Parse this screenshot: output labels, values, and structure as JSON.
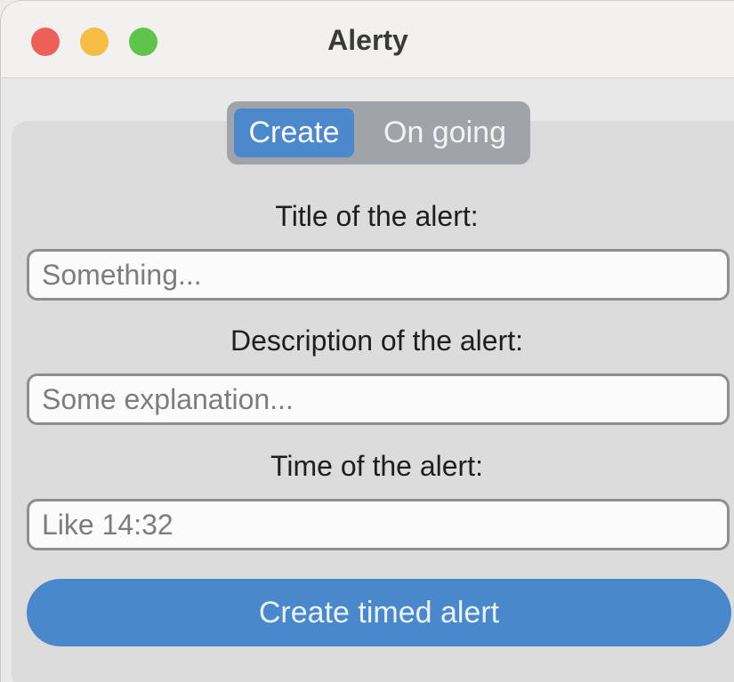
{
  "window": {
    "title": "Alerty"
  },
  "tabs": [
    {
      "label": "Create",
      "active": true
    },
    {
      "label": "On going",
      "active": false
    }
  ],
  "form": {
    "title_label": "Title of the alert:",
    "title_placeholder": "Something...",
    "description_label": "Description of the alert:",
    "description_placeholder": "Some explanation...",
    "time_label": "Time of the alert:",
    "time_placeholder": "Like 14:32",
    "submit_label": "Create timed alert"
  },
  "colors": {
    "accent": "#4a88cc",
    "close": "#ee5f58",
    "minimize": "#f6bd45",
    "maximize": "#5ec54a"
  }
}
